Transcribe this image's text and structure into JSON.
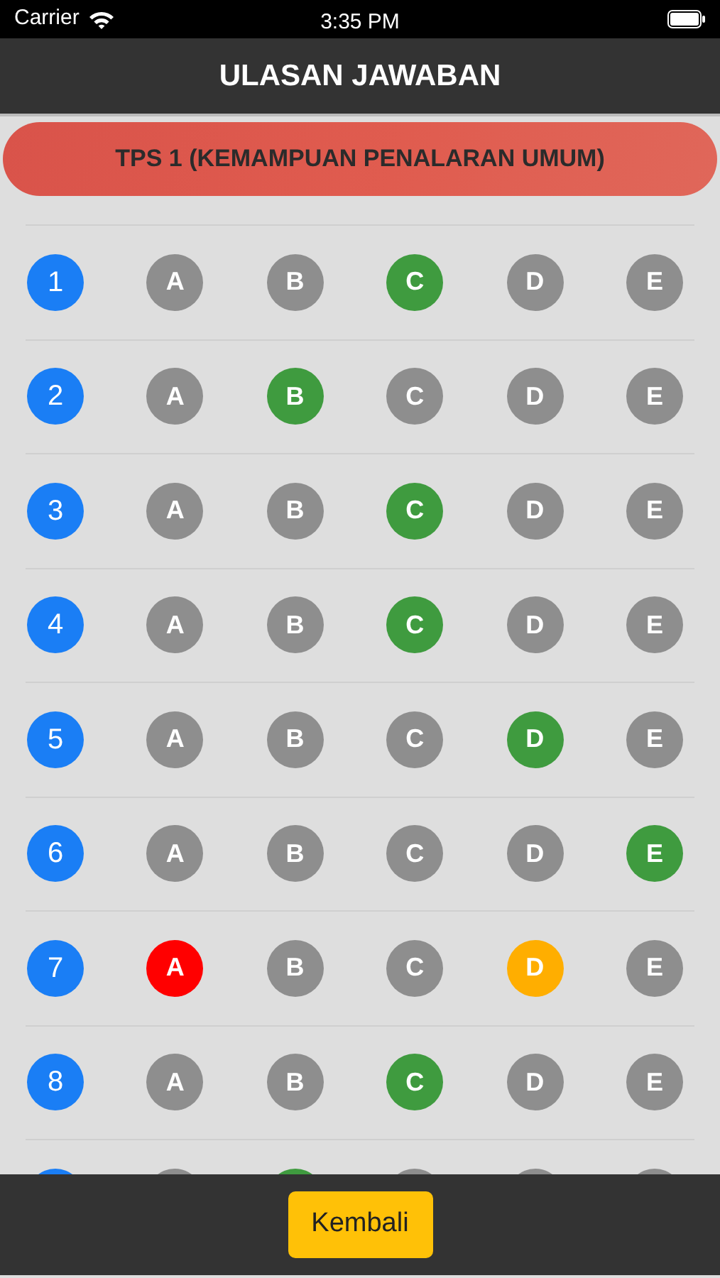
{
  "status_bar": {
    "carrier": "Carrier",
    "time": "3:35 PM"
  },
  "header": {
    "title": "ULASAN JAWABAN"
  },
  "section": {
    "title": "TPS 1 (KEMAMPUAN PENALARAN UMUM)"
  },
  "questions": [
    {
      "number": "1",
      "options": [
        {
          "label": "A",
          "color": "#8e8e8e"
        },
        {
          "label": "B",
          "color": "#8e8e8e"
        },
        {
          "label": "C",
          "color": "#3f9b3f"
        },
        {
          "label": "D",
          "color": "#8e8e8e"
        },
        {
          "label": "E",
          "color": "#8e8e8e"
        }
      ]
    },
    {
      "number": "2",
      "options": [
        {
          "label": "A",
          "color": "#8e8e8e"
        },
        {
          "label": "B",
          "color": "#3f9b3f"
        },
        {
          "label": "C",
          "color": "#8e8e8e"
        },
        {
          "label": "D",
          "color": "#8e8e8e"
        },
        {
          "label": "E",
          "color": "#8e8e8e"
        }
      ]
    },
    {
      "number": "3",
      "options": [
        {
          "label": "A",
          "color": "#8e8e8e"
        },
        {
          "label": "B",
          "color": "#8e8e8e"
        },
        {
          "label": "C",
          "color": "#3f9b3f"
        },
        {
          "label": "D",
          "color": "#8e8e8e"
        },
        {
          "label": "E",
          "color": "#8e8e8e"
        }
      ]
    },
    {
      "number": "4",
      "options": [
        {
          "label": "A",
          "color": "#8e8e8e"
        },
        {
          "label": "B",
          "color": "#8e8e8e"
        },
        {
          "label": "C",
          "color": "#3f9b3f"
        },
        {
          "label": "D",
          "color": "#8e8e8e"
        },
        {
          "label": "E",
          "color": "#8e8e8e"
        }
      ]
    },
    {
      "number": "5",
      "options": [
        {
          "label": "A",
          "color": "#8e8e8e"
        },
        {
          "label": "B",
          "color": "#8e8e8e"
        },
        {
          "label": "C",
          "color": "#8e8e8e"
        },
        {
          "label": "D",
          "color": "#3f9b3f"
        },
        {
          "label": "E",
          "color": "#8e8e8e"
        }
      ]
    },
    {
      "number": "6",
      "options": [
        {
          "label": "A",
          "color": "#8e8e8e"
        },
        {
          "label": "B",
          "color": "#8e8e8e"
        },
        {
          "label": "C",
          "color": "#8e8e8e"
        },
        {
          "label": "D",
          "color": "#8e8e8e"
        },
        {
          "label": "E",
          "color": "#3f9b3f"
        }
      ]
    },
    {
      "number": "7",
      "options": [
        {
          "label": "A",
          "color": "#ff0000"
        },
        {
          "label": "B",
          "color": "#8e8e8e"
        },
        {
          "label": "C",
          "color": "#8e8e8e"
        },
        {
          "label": "D",
          "color": "#ffae00"
        },
        {
          "label": "E",
          "color": "#8e8e8e"
        }
      ]
    },
    {
      "number": "8",
      "options": [
        {
          "label": "A",
          "color": "#8e8e8e"
        },
        {
          "label": "B",
          "color": "#8e8e8e"
        },
        {
          "label": "C",
          "color": "#3f9b3f"
        },
        {
          "label": "D",
          "color": "#8e8e8e"
        },
        {
          "label": "E",
          "color": "#8e8e8e"
        }
      ]
    },
    {
      "options": [
        {
          "color": "#8e8e8e"
        },
        {
          "color": "#3f9b3f"
        },
        {
          "color": "#8e8e8e"
        },
        {
          "color": "#8e8e8e"
        },
        {
          "color": "#8e8e8e"
        }
      ]
    }
  ],
  "footer": {
    "button": "Kembali"
  }
}
